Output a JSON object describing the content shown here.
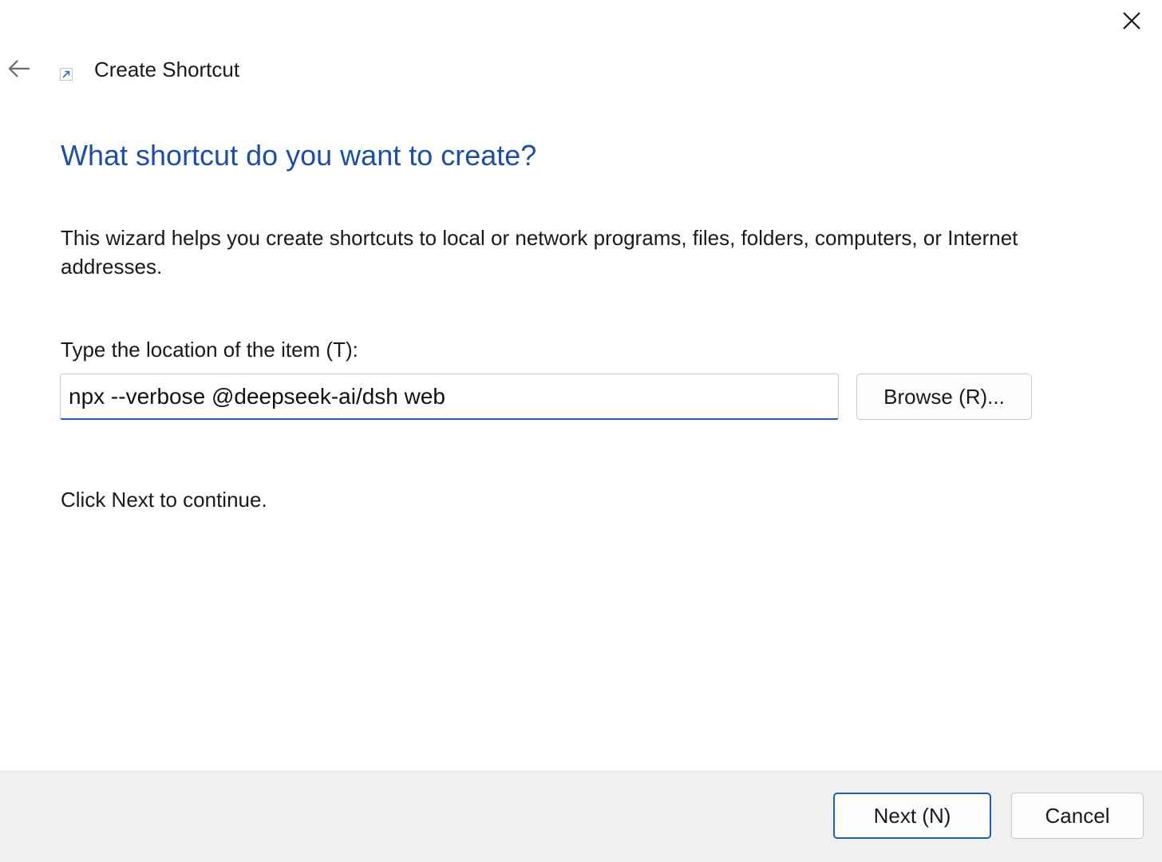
{
  "window": {
    "title": "Create Shortcut",
    "close_icon": "close-icon",
    "back_icon": "back-arrow-icon",
    "title_icon": "shortcut-icon"
  },
  "main": {
    "heading": "What shortcut do you want to create?",
    "description": "This wizard helps you create shortcuts to local or network programs, files, folders, computers, or Internet addresses.",
    "location_label": "Type the location of the item (T):",
    "location_value": "npx --verbose @deepseek-ai/dsh web",
    "browse_label": "Browse (R)...",
    "continue_text": "Click Next to continue."
  },
  "footer": {
    "next_label": "Next (N)",
    "cancel_label": "Cancel"
  },
  "colors": {
    "heading": "#1f4ea5",
    "accent": "#1f5fae",
    "footer_bg": "#f0f0f0"
  }
}
